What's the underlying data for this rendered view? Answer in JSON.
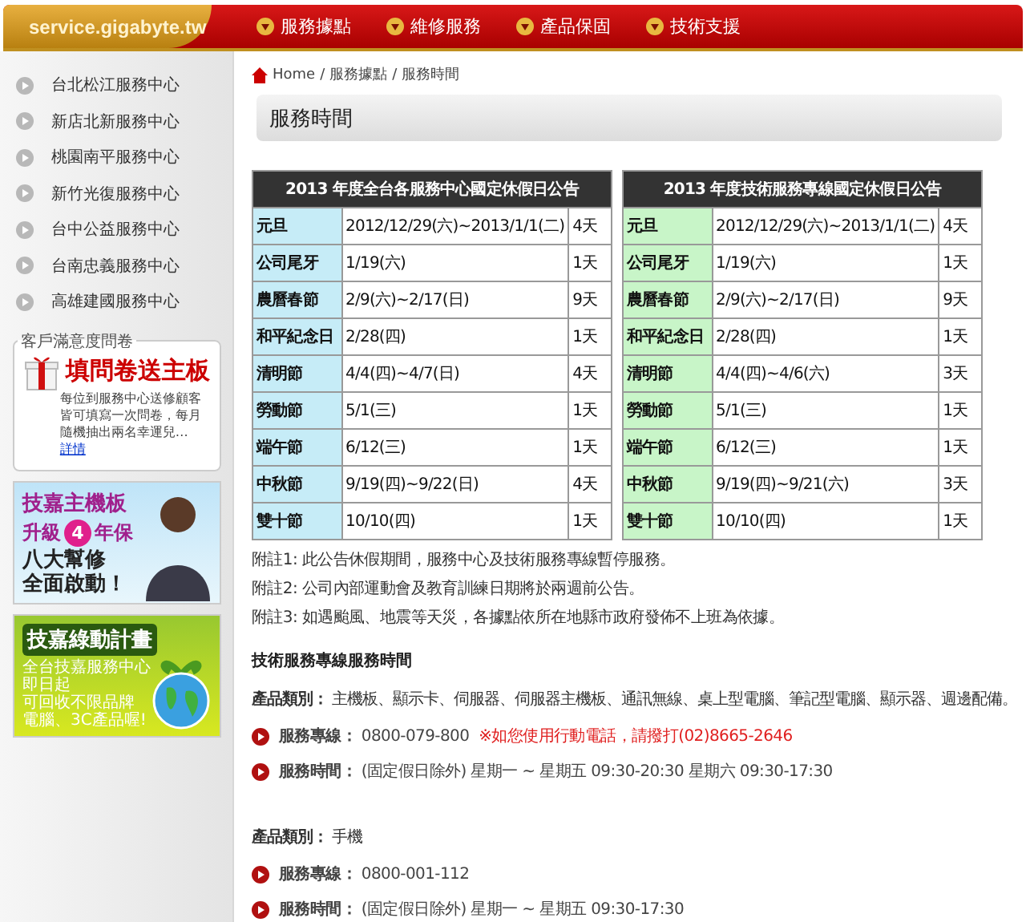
{
  "header": {
    "site": "service.gigabyte.tw",
    "nav": [
      "服務據點",
      "維修服務",
      "產品保固",
      "技術支援"
    ]
  },
  "sidebar": {
    "centers": [
      "台北松江服務中心",
      "新店北新服務中心",
      "桃園南平服務中心",
      "新竹光復服務中心",
      "台中公益服務中心",
      "台南忠義服務中心",
      "高雄建國服務中心"
    ],
    "survey": {
      "legend": "客戶滿意度問卷",
      "title": "填問卷送主板",
      "body": "每位到服務中心送修顧客皆可填寫一次問卷，每月隨機抽出兩名幸運兒…",
      "link": "詳情"
    },
    "banners": [
      {
        "kind": "upgrade",
        "title": "技嘉主機板",
        "lead": "升級",
        "number": "4",
        "tail": "年保",
        "lines": [
          "八大幫修",
          "全面啟動！"
        ]
      },
      {
        "kind": "green",
        "title": "技嘉綠動計畫",
        "lines": [
          "全台技嘉服務中心",
          "即日起",
          "可回收不限品牌",
          "電腦、3C產品喔!"
        ]
      }
    ]
  },
  "breadcrumb": {
    "items": [
      "Home",
      "服務據點",
      "服務時間"
    ],
    "separators": [
      "/",
      "/"
    ]
  },
  "page_title": "服務時間",
  "tables": [
    {
      "title": "2013 年度全台各服務中心國定休假日公告",
      "color": "#c6ecf7",
      "rows": [
        [
          "元旦",
          "2012/12/29(六)~2013/1/1(二)",
          "4天"
        ],
        [
          "公司尾牙",
          "1/19(六)",
          "1天"
        ],
        [
          "農曆春節",
          "2/9(六)~2/17(日)",
          "9天"
        ],
        [
          "和平紀念日",
          "2/28(四)",
          "1天"
        ],
        [
          "清明節",
          "4/4(四)~4/7(日)",
          "4天"
        ],
        [
          "勞動節",
          "5/1(三)",
          "1天"
        ],
        [
          "端午節",
          "6/12(三)",
          "1天"
        ],
        [
          "中秋節",
          "9/19(四)~9/22(日)",
          "4天"
        ],
        [
          "雙十節",
          "10/10(四)",
          "1天"
        ]
      ]
    },
    {
      "title": "2013 年度技術服務專線國定休假日公告",
      "color": "#c8f5c8",
      "rows": [
        [
          "元旦",
          "2012/12/29(六)~2013/1/1(二)",
          "4天"
        ],
        [
          "公司尾牙",
          "1/19(六)",
          "1天"
        ],
        [
          "農曆春節",
          "2/9(六)~2/17(日)",
          "9天"
        ],
        [
          "和平紀念日",
          "2/28(四)",
          "1天"
        ],
        [
          "清明節",
          "4/4(四)~4/6(六)",
          "3天"
        ],
        [
          "勞動節",
          "5/1(三)",
          "1天"
        ],
        [
          "端午節",
          "6/12(三)",
          "1天"
        ],
        [
          "中秋節",
          "9/19(四)~9/21(六)",
          "3天"
        ],
        [
          "雙十節",
          "10/10(四)",
          "1天"
        ]
      ]
    }
  ],
  "notes": [
    "附註1: 此公告休假期間，服務中心及技術服務專線暫停服務。",
    "附註2: 公司內部運動會及教育訓練日期將於兩週前公告。",
    "附註3: 如遇颱風、地震等天災，各據點依所在地縣市政府發佈不上班為依據。"
  ],
  "section_heading": "技術服務專線服務時間",
  "groups": [
    {
      "category_label": "產品類別：",
      "category": "主機板、顯示卡、伺服器、伺服器主機板、通訊無線、桌上型電腦、筆記型電腦、顯示器、週邊配備。",
      "items": [
        {
          "label": "服務專線：",
          "value": "0800-079-800",
          "note": "※如您使用行動電話，請撥打(02)8665-2646"
        },
        {
          "label": "服務時間：",
          "value": "(固定假日除外) 星期一 ~ 星期五 09:30-20:30 星期六 09:30-17:30"
        }
      ]
    },
    {
      "category_label": "產品類別：",
      "category": "手機",
      "items": [
        {
          "label": "服務專線：",
          "value": "0800-001-112"
        },
        {
          "label": "服務時間：",
          "value": "(固定假日除外) 星期一 ~ 星期五 09:30-17:30"
        }
      ]
    }
  ]
}
